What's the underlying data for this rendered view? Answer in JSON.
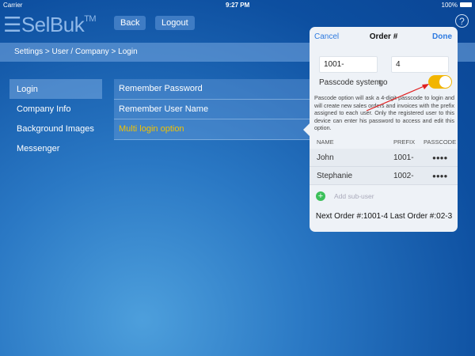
{
  "status": {
    "carrier": "Carrier",
    "time": "9:27 PM",
    "battery": "100%"
  },
  "header": {
    "logo": "SelBuk",
    "tm": "TM",
    "back": "Back",
    "logout": "Logout",
    "help": "?"
  },
  "breadcrumb": "Settings > User / Company > Login",
  "sidebar": [
    "Login",
    "Company Info",
    "Background Images",
    "Messenger"
  ],
  "options": [
    "Remember Password",
    "Remember User Name",
    "Multi login option"
  ],
  "popover": {
    "cancel": "Cancel",
    "title": "Order #",
    "done": "Done",
    "prefix_value": "1001-",
    "number_value": "4",
    "passcode_label": "Passcode system",
    "overlap_text": "go",
    "passcode_on": true,
    "description": "Pascode option will ask a 4-digit passcode to login and will create new sales orders and invoices with the prefix assigned to each user. Only the registered user to this device can enter his password to access and edit this option.",
    "columns": [
      "NAME",
      "PREFIX",
      "PASSCODE"
    ],
    "users": [
      {
        "name": "John",
        "prefix": "1001-",
        "passcode": "●●●●"
      },
      {
        "name": "Stephanie",
        "prefix": "1002-",
        "passcode": "●●●●"
      }
    ],
    "add_user": "Add sub-user",
    "footer": "Next Order #:1001-4 Last Order #:02-3"
  }
}
